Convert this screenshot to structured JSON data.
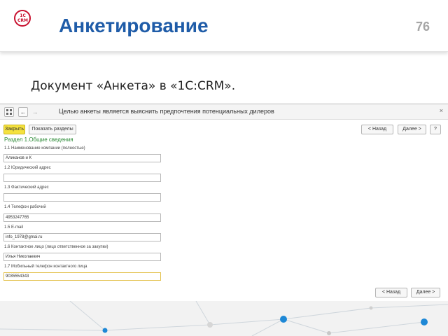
{
  "slide": {
    "title": "Анкетирование",
    "number": "76",
    "subtitle": "Документ «Анкета» в «1С:CRM».",
    "logo_text": "1C CRM"
  },
  "window": {
    "title": "Целью анкеты является выяснить предпочтения потенциальных дилеров",
    "nav_back": "←",
    "nav_forward": "→",
    "close_symbol": "×"
  },
  "toolbar": {
    "close_label": "Закрыть",
    "show_sections_label": "Показать разделы",
    "back_label": "< Назад",
    "next_label": "Далее >",
    "help_label": "?"
  },
  "form": {
    "section_title": "Раздел 1.Общие сведения",
    "fields": [
      {
        "label": "1.1 Наименование компании (полностью)",
        "value": "Аликанов и К"
      },
      {
        "label": "1.2 Юридический адрес",
        "value": ""
      },
      {
        "label": "1.3 Фактический адрес",
        "value": ""
      },
      {
        "label": "1.4 Телефон рабочий",
        "value": "4953247765"
      },
      {
        "label": "1.5 E-mail",
        "value": "info_1978@gmai.ru"
      },
      {
        "label": "1.6 Контактное лицо (лицо ответственное за закупки)",
        "value": "Илья Николаевич"
      },
      {
        "label": "1.7 Мобильный телефон контактного лица",
        "value": "9035554343"
      }
    ]
  },
  "footer_nav": {
    "back_label": "< Назад",
    "next_label": "Далее >"
  },
  "colors": {
    "title_blue": "#1f5ca8",
    "logo_red": "#c8102e",
    "section_green": "#2b8a35",
    "close_button_yellow": "#f5e23e",
    "network_node_blue": "#1e88d6"
  },
  "icons": {
    "app_menu": "grid-icon",
    "home": "home-icon",
    "favorite": "star-icon"
  }
}
